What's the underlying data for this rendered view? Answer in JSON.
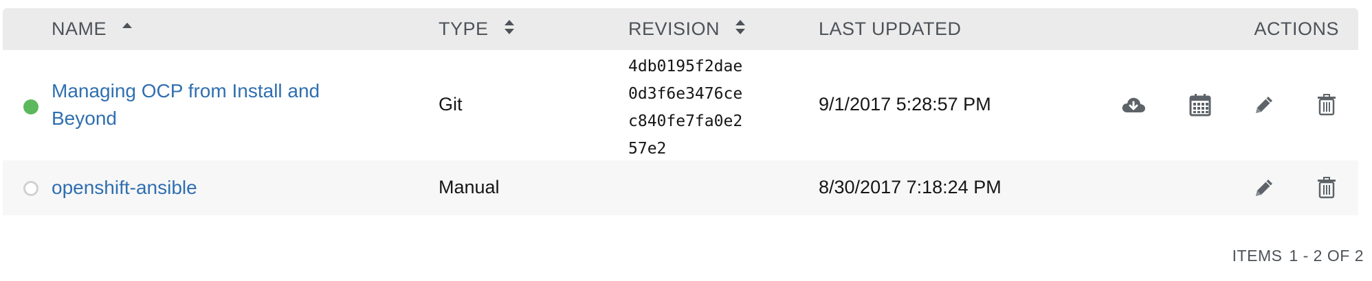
{
  "table": {
    "columns": [
      {
        "label": "NAME",
        "sort": "ascending"
      },
      {
        "label": "TYPE",
        "sort": "both"
      },
      {
        "label": "REVISION",
        "sort": "both"
      },
      {
        "label": "LAST UPDATED",
        "sort": "none"
      },
      {
        "label": "ACTIONS",
        "sort": "none"
      }
    ],
    "rows": [
      {
        "status": "active",
        "status_color": "#5cb85c",
        "name_line1": "Managing OCP from Install and",
        "name_line2": "Beyond",
        "type": "Git",
        "revision": [
          "4db0195f2dae",
          "0d3f6e3476ce",
          "c840fe7fa0e2",
          "57e2"
        ],
        "last_updated": "9/1/2017 5:28:57 PM",
        "actions": [
          "cloud-download-icon",
          "calendar-icon",
          "pencil-icon",
          "trash-icon"
        ]
      },
      {
        "status": "inactive",
        "status_color": "#d1d1d1",
        "name_line1": "openshift-ansible",
        "type": "Manual",
        "revision": [],
        "last_updated": "8/30/2017 7:18:24 PM",
        "actions": [
          "pencil-icon",
          "trash-icon"
        ]
      }
    ]
  },
  "pagination": {
    "label": "ITEMS",
    "range": "1 - 2 OF 2"
  },
  "colors": {
    "link": "#2f6fb0",
    "header_bg": "#ebebeb",
    "icon": "#5d6368"
  }
}
